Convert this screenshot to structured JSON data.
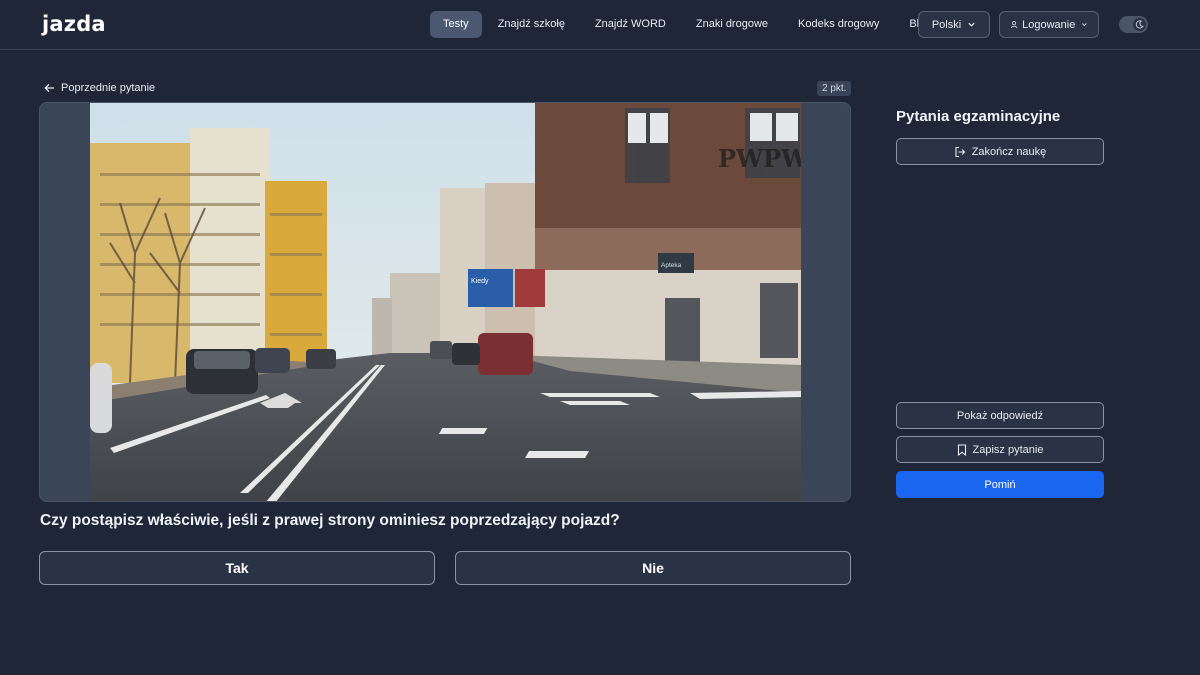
{
  "header": {
    "logo": "jazda",
    "nav": [
      {
        "label": "Testy",
        "active": true
      },
      {
        "label": "Znajdź szkołę",
        "active": false
      },
      {
        "label": "Znajdź WORD",
        "active": false
      },
      {
        "label": "Znaki drogowe",
        "active": false
      },
      {
        "label": "Kodeks drogowy",
        "active": false
      },
      {
        "label": "Blog",
        "active": false
      }
    ],
    "language": "Polski",
    "login": "Logowanie"
  },
  "question": {
    "prev_label": "Poprzednie pytanie",
    "points": "2 pkt.",
    "text": "Czy postąpisz właściwie, jeśli z prawej strony ominiesz poprzedzający pojazd?",
    "media": {
      "watermark": "PWPW",
      "billboard_text": "Kiedy",
      "shop_sign": "Apteka"
    },
    "answers": {
      "yes": "Tak",
      "no": "Nie"
    }
  },
  "sidebar": {
    "title": "Pytania egzaminacyjne",
    "end_label": "Zakończ naukę",
    "show_answer_label": "Pokaż odpowiedź",
    "save_label": "Zapisz pytanie",
    "skip_label": "Pomiń"
  },
  "colors": {
    "background": "#1e2638",
    "accent": "#1a66f0",
    "nav_active": "#4b5870"
  }
}
